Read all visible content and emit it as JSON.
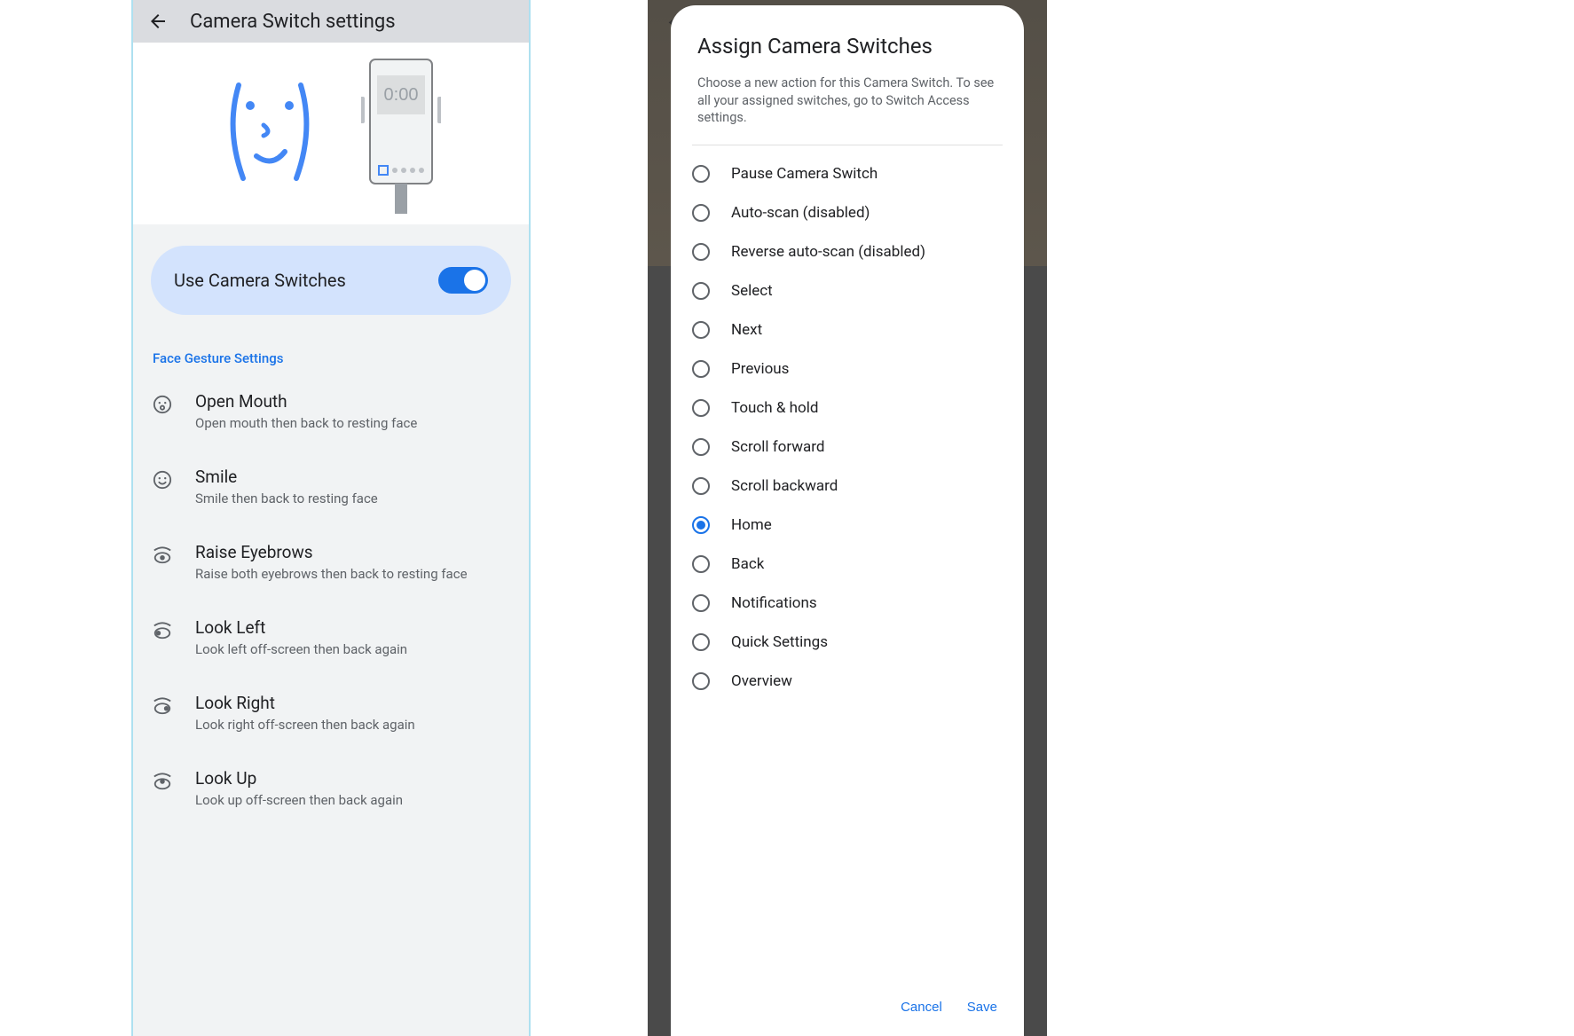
{
  "left": {
    "header_title": "Camera Switch settings",
    "toggle_label": "Use Camera Switches",
    "toggle_on": true,
    "section_label": "Face Gesture Settings",
    "illustration_time": "0:00",
    "gestures": [
      {
        "icon": "open-mouth-icon",
        "title": "Open Mouth",
        "desc": "Open mouth then back to resting face"
      },
      {
        "icon": "smile-icon",
        "title": "Smile",
        "desc": "Smile then back to resting face"
      },
      {
        "icon": "raise-eyebrows-icon",
        "title": "Raise Eyebrows",
        "desc": "Raise both eyebrows then back to resting face"
      },
      {
        "icon": "look-left-icon",
        "title": "Look Left",
        "desc": "Look left off-screen then back again"
      },
      {
        "icon": "look-right-icon",
        "title": "Look Right",
        "desc": "Look right off-screen then back again"
      },
      {
        "icon": "look-up-icon",
        "title": "Look Up",
        "desc": "Look up off-screen then back again"
      }
    ]
  },
  "right": {
    "dialog_title": "Assign Camera Switches",
    "dialog_desc": "Choose a new action for this Camera Switch. To see all your assigned switches, go to Switch Access settings.",
    "options": [
      {
        "label": "Pause Camera Switch",
        "selected": false
      },
      {
        "label": "Auto-scan (disabled)",
        "selected": false
      },
      {
        "label": "Reverse auto-scan (disabled)",
        "selected": false
      },
      {
        "label": "Select",
        "selected": false
      },
      {
        "label": "Next",
        "selected": false
      },
      {
        "label": "Previous",
        "selected": false
      },
      {
        "label": "Touch & hold",
        "selected": false
      },
      {
        "label": "Scroll forward",
        "selected": false
      },
      {
        "label": "Scroll backward",
        "selected": false
      },
      {
        "label": "Home",
        "selected": true
      },
      {
        "label": "Back",
        "selected": false
      },
      {
        "label": "Notifications",
        "selected": false
      },
      {
        "label": "Quick Settings",
        "selected": false
      },
      {
        "label": "Overview",
        "selected": false
      }
    ],
    "cancel_label": "Cancel",
    "save_label": "Save"
  }
}
